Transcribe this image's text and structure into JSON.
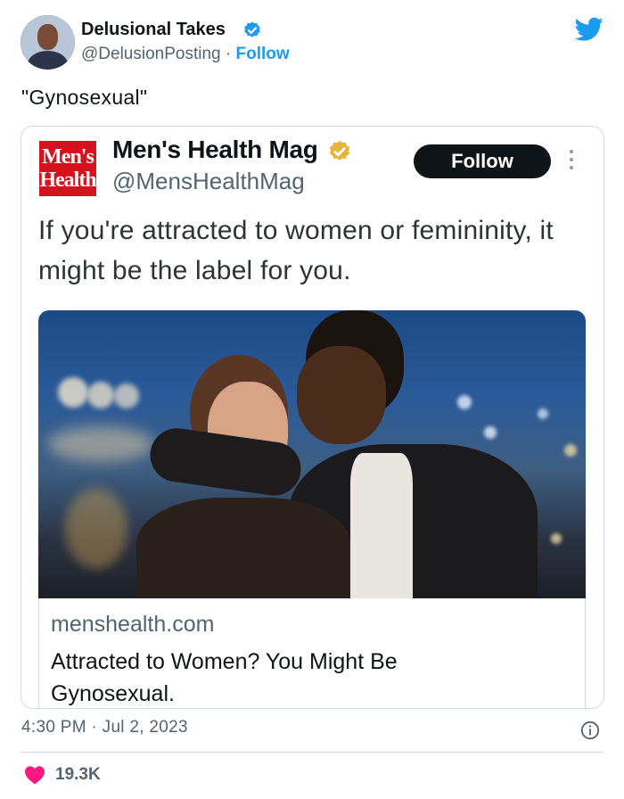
{
  "tweet": {
    "author_name": "Delusional Takes",
    "author_handle": "@DelusionPosting",
    "separator": "·",
    "follow_label": "Follow",
    "text": "\"Gynosexual\"",
    "timestamp": "4:30 PM · Jul 2, 2023",
    "likes": "19.3K"
  },
  "quoted_tweet": {
    "logo_text_1": "Men's",
    "logo_text_2": "Health",
    "author_name": "Men's Health Mag",
    "author_handle": "@MensHealthMag",
    "follow_label": "Follow",
    "text": "If you're attracted to women or femininity, it might be the label for you.",
    "link_card": {
      "source": "menshealth.com",
      "title": "Attracted to Women? You Might Be Gynosexual."
    }
  },
  "icons": {
    "verified": "verified-badge-icon",
    "brand": "twitter-bird-icon",
    "info": "info-icon",
    "like": "heart-icon",
    "more": "more-vertical-icon"
  },
  "colors": {
    "accent_blue": "#1d9bf0",
    "gold_badge": "#e8b53a",
    "like_pink": "#f91880",
    "mh_red": "#d6121e",
    "follow_button": "#0f1419",
    "muted_text": "#536471"
  }
}
